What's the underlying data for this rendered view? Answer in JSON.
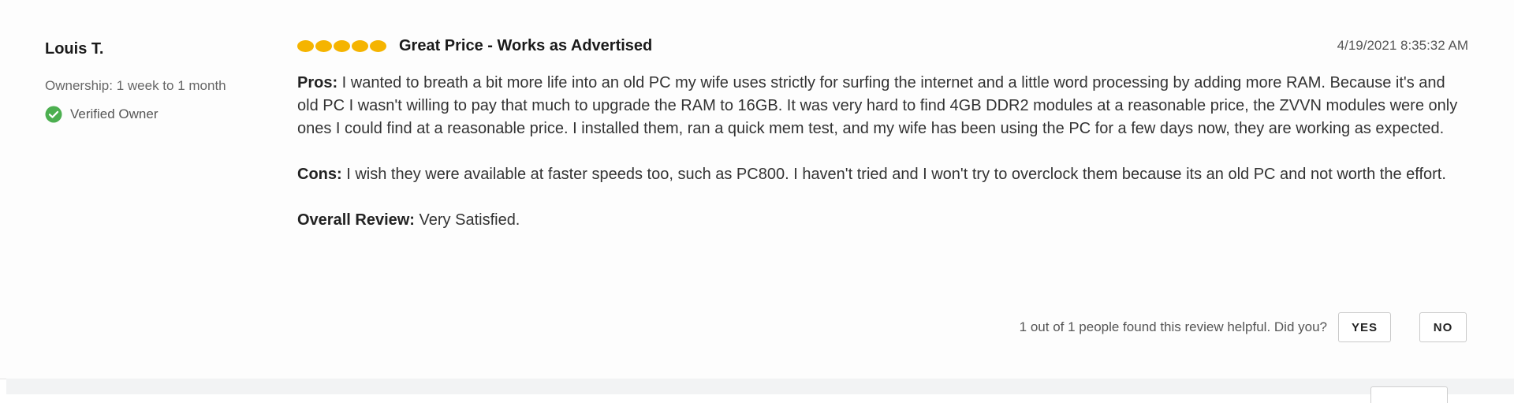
{
  "reviewer": {
    "name": "Louis T.",
    "ownership": "Ownership: 1 week to 1 month",
    "verified_label": "Verified Owner",
    "verified_icon": "check-circle-icon"
  },
  "review": {
    "rating": 5,
    "rating_max": 5,
    "title": "Great Price - Works as Advertised",
    "date": "4/19/2021 8:35:32 AM",
    "pros_label": "Pros:",
    "pros_text": " I wanted to breath a bit more life into an old PC my wife uses strictly for surfing the internet and a little word processing by adding more RAM. Because it's and old PC I wasn't willing to pay that much to upgrade the RAM to 16GB. It was very hard to find 4GB DDR2 modules at a reasonable price, the ZVVN modules were only ones I could find at a reasonable price. I installed them, ran a quick mem test, and my wife has been using the PC for a few days now, they are working as expected.",
    "cons_label": "Cons:",
    "cons_text": " I wish they were available at faster speeds too, such as PC800. I haven't tried and I won't try to overclock them because its an old PC and not worth the effort.",
    "overall_label": "Overall Review:",
    "overall_text": " Very Satisfied."
  },
  "helpful": {
    "text": "1 out of 1 people found this review helpful. Did you?",
    "yes_label": "YES",
    "no_label": "NO"
  },
  "colors": {
    "star": "#f5b400",
    "verified": "#4caf50"
  }
}
